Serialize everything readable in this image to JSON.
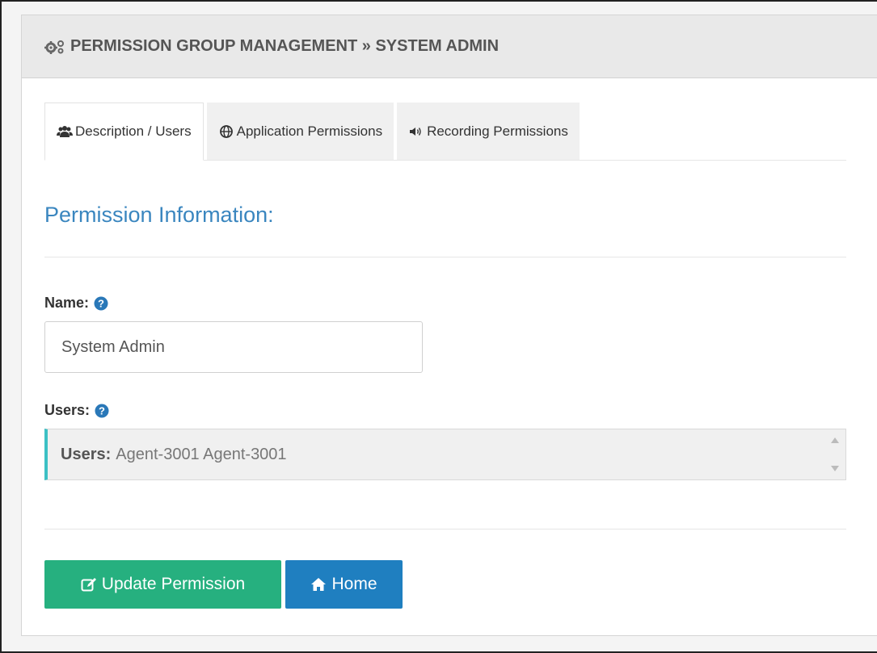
{
  "header": {
    "title": "PERMISSION GROUP MANAGEMENT » SYSTEM ADMIN",
    "icon": "cogs-icon"
  },
  "tabs": [
    {
      "label": "Description / Users",
      "icon": "users-icon",
      "active": true
    },
    {
      "label": "Application Permissions",
      "icon": "globe-icon",
      "active": false
    },
    {
      "label": "Recording Permissions",
      "icon": "volume-icon",
      "active": false
    }
  ],
  "section": {
    "title": "Permission Information:"
  },
  "name_field": {
    "label": "Name:",
    "value": "System Admin"
  },
  "users_field": {
    "label": "Users:",
    "prefix": "Users:",
    "value": "Agent-3001 Agent-3001"
  },
  "actions": {
    "update_label": "Update Permission",
    "home_label": "Home"
  },
  "colors": {
    "accent_blue": "#3a86bf",
    "green_button": "#26b07f",
    "blue_button": "#1f7fc0",
    "select_border": "#3cc0c4"
  }
}
